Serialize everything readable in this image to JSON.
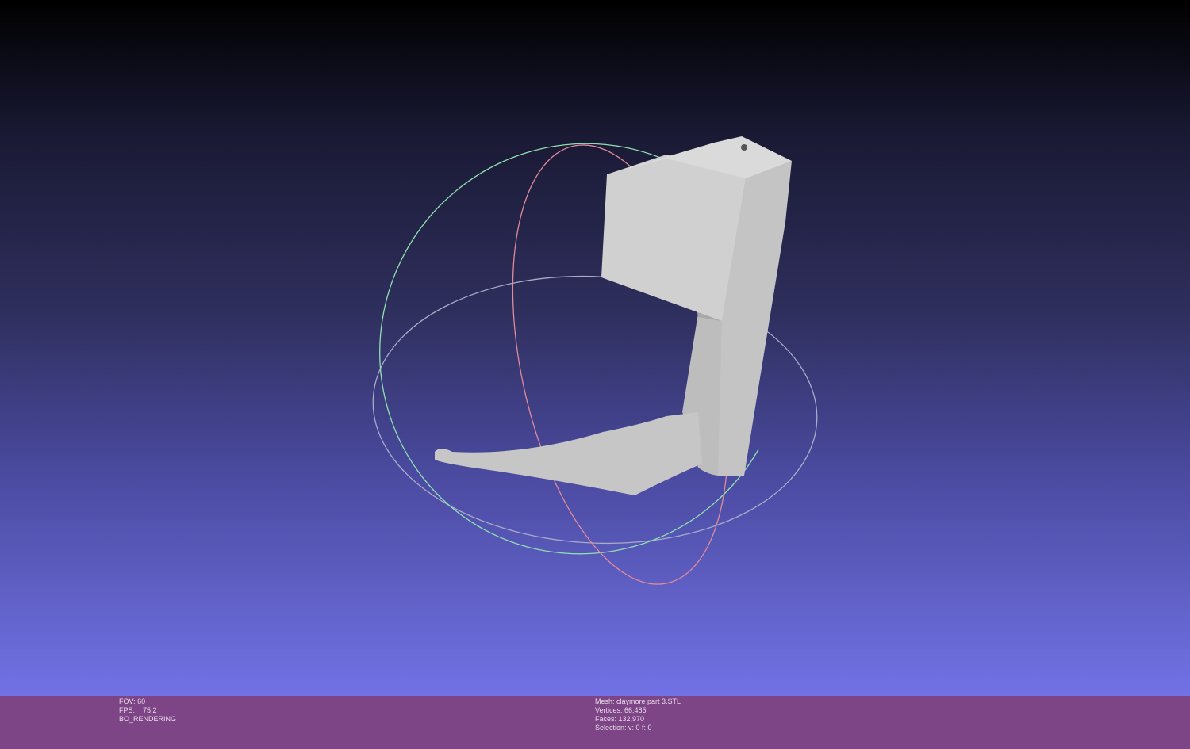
{
  "viewer": {
    "left_info": {
      "fov": "FOV: 60",
      "fps": "FPS:    75.2",
      "mode": "BO_RENDERING"
    },
    "right_info": {
      "mesh": "Mesh: claymore part 3.STL",
      "vertices": "Vertices: 66,485",
      "faces": "Faces: 132,970",
      "selection": "Selection: v: 0 f: 0"
    }
  },
  "colors": {
    "statusbar": "#7d4585",
    "gradient_top": "#000000",
    "gradient_bottom": "#7272e6",
    "mesh": "#c8c8c8"
  }
}
